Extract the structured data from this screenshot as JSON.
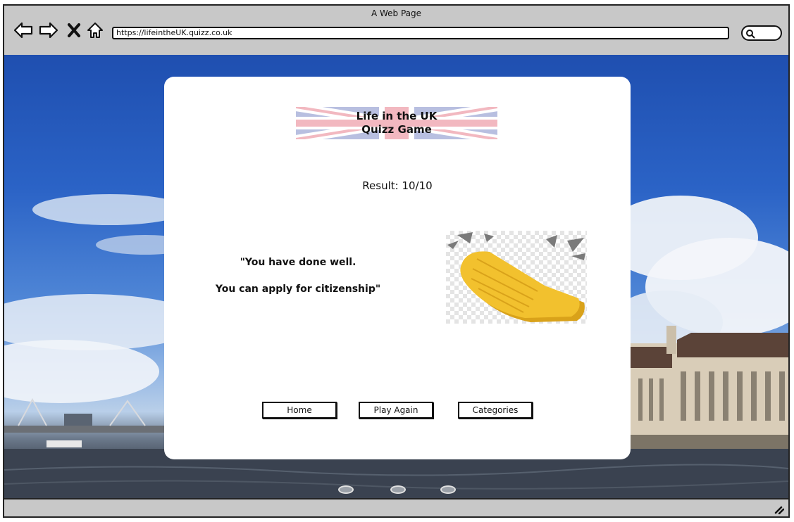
{
  "window": {
    "title": "A Web Page"
  },
  "toolbar": {
    "back_icon": "back-arrow-icon",
    "forward_icon": "forward-arrow-icon",
    "stop_icon": "close-icon",
    "home_icon": "home-icon",
    "url": "https://lifeintheUK.quizz.co.uk",
    "search_icon": "search-icon"
  },
  "card": {
    "logo": {
      "line1": "Life in the UK",
      "line2": "Quizz Game"
    },
    "result": "Result: 10/10",
    "message": {
      "line1": "\"You have done well.",
      "line2": "You can apply for citizenship\""
    },
    "image_icon": "clapping-hands-icon",
    "buttons": {
      "home": "Home",
      "play_again": "Play Again",
      "categories": "Categories"
    }
  },
  "carousel": {
    "dots": 3
  },
  "colors": {
    "flag_blue": "#b8bfe0",
    "flag_red": "#f2b8c0",
    "hand_yellow": "#f2c12e",
    "hand_shadow": "#d9a21a"
  }
}
